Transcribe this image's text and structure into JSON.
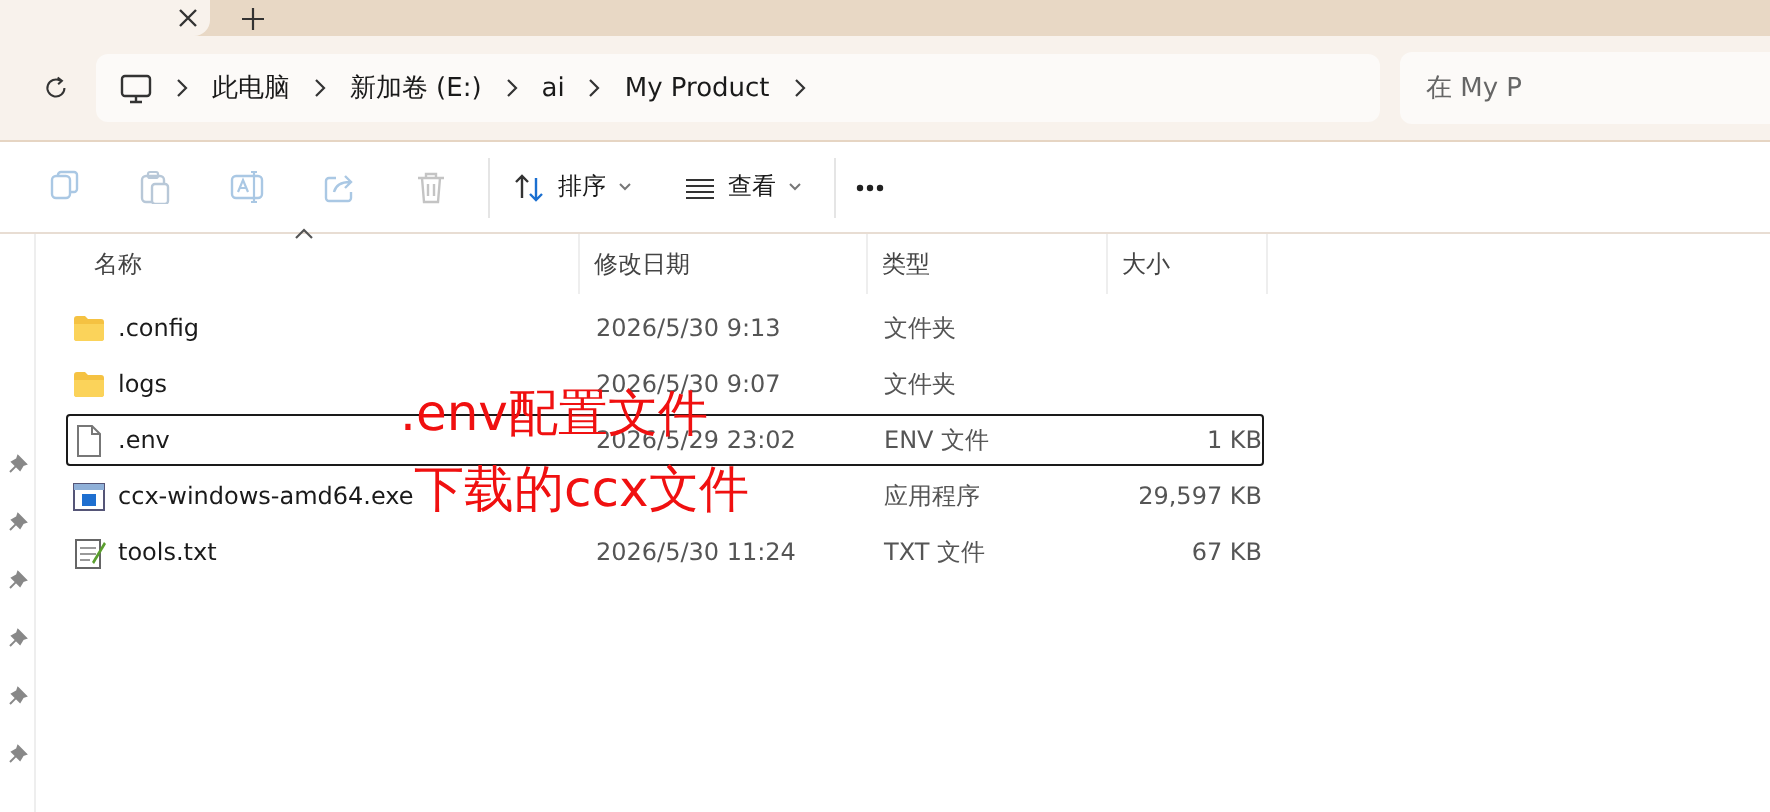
{
  "address_bar": {
    "breadcrumbs": [
      "此电脑",
      "新加卷 (E:)",
      "ai",
      "My Product"
    ],
    "search": {
      "placeholder": "在 My P"
    }
  },
  "toolbar": {
    "icon_buttons": [
      {
        "disabled": true
      },
      {
        "disabled": true
      },
      {
        "disabled": true
      },
      {
        "disabled": true
      },
      {
        "disabled": true
      }
    ],
    "menus": [
      {
        "label": "排序"
      },
      {
        "label": "查看"
      }
    ]
  },
  "file_list": {
    "columns": [
      {
        "label": "名称",
        "sorted": true
      },
      {
        "label": "修改日期",
        "sorted": false
      },
      {
        "label": "类型",
        "sorted": false
      },
      {
        "label": "大小",
        "sorted": false
      }
    ],
    "rows": [
      {
        "kind": "folder",
        "name": ".config",
        "date": "2026/5/30 9:13",
        "type": "文件夹",
        "selected": false
      },
      {
        "kind": "folder",
        "name": "logs",
        "date": "2026/5/30 9:07",
        "type": "文件夹",
        "selected": false
      },
      {
        "kind": "file",
        "name": ".env",
        "date": "2026/5/29 23:02",
        "type": "ENV 文件",
        "size": "1 KB",
        "selected": true
      },
      {
        "kind": "exe",
        "name": "ccx-windows-amd64.exe",
        "type": "应用程序",
        "size": "29,597 KB",
        "selected": false
      },
      {
        "kind": "text",
        "name": "tools.txt",
        "date": "2026/5/30 11:24",
        "type": "TXT 文件",
        "size": "67 KB",
        "selected": false
      }
    ]
  },
  "annotations": [
    {
      "text": ".env配置文件"
    },
    {
      "text": "下载的ccx文件"
    }
  ]
}
